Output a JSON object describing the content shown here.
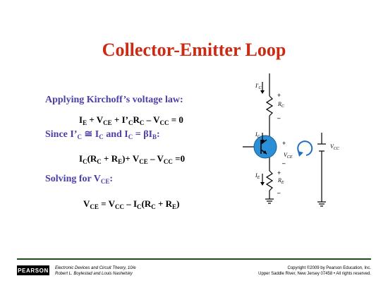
{
  "slide": {
    "title": "Collector-Emitter Loop",
    "kvl_label": "Applying Kirchoff’s voltage law:",
    "solve_label_text": "Solving for V",
    "solve_label_sub": "CE",
    "solve_label_end": ":"
  },
  "equations": {
    "eq1": {
      "p1": "I",
      "s1": "E",
      "p2": " + V",
      "s2": "CE",
      "p3": " + I’",
      "s3": "C",
      "p4": "R",
      "s4": "C",
      "p5": " – V",
      "s5": "CC",
      "p6": " = 0"
    },
    "since": {
      "p1": "Since I’",
      "s1": "C",
      "p2": " ≅ I",
      "s2": "C",
      "p3": " and I",
      "s3": "C",
      "p4": " = βI",
      "s4": "B",
      "p5": ":"
    },
    "eq2": {
      "p1": "I",
      "s1": "C",
      "p2": "(R",
      "s2": "C",
      "p3": " + R",
      "s3": "E",
      "p4": ")+ V",
      "s4": "CE",
      "p5": " – V",
      "s5": "CC",
      "p6": " =0"
    },
    "eq3": {
      "p1": "V",
      "s1": "CE",
      "p2": " = V",
      "s2": "CC",
      "p3": " – I",
      "s3": "C",
      "p4": "(R",
      "s4": "C",
      "p5": " + R",
      "s5": "E",
      "p6": ")"
    }
  },
  "circuit": {
    "ic_prime": "I′",
    "ic_prime_sub": "C",
    "ic": "I",
    "ic_sub": "C",
    "ie": "I",
    "ie_sub": "E",
    "rc": "R",
    "rc_sub": "C",
    "re": "R",
    "re_sub": "E",
    "vce": "V",
    "vce_sub": "CE",
    "vcc": "V",
    "vcc_sub": "CC",
    "plus": "+",
    "minus": "–"
  },
  "footer": {
    "logo": "PEARSON",
    "book_line1": "Electronic Devices and Circuit Theory, 10/e",
    "book_line2": "Robert L. Boylestad and Louis Nashelsky",
    "copyright_line1": "Copyright ©2009 by Pearson Education, Inc.",
    "copyright_line2": "Upper Saddle River, New Jersey 07458 • All rights reserved."
  },
  "colors": {
    "title": "#cc2a12",
    "label": "#4a3fa8",
    "transistor_fill": "#2a8fd6",
    "loop_arrow": "#1f6fc4",
    "footer_rule": "#1a4f1a"
  }
}
